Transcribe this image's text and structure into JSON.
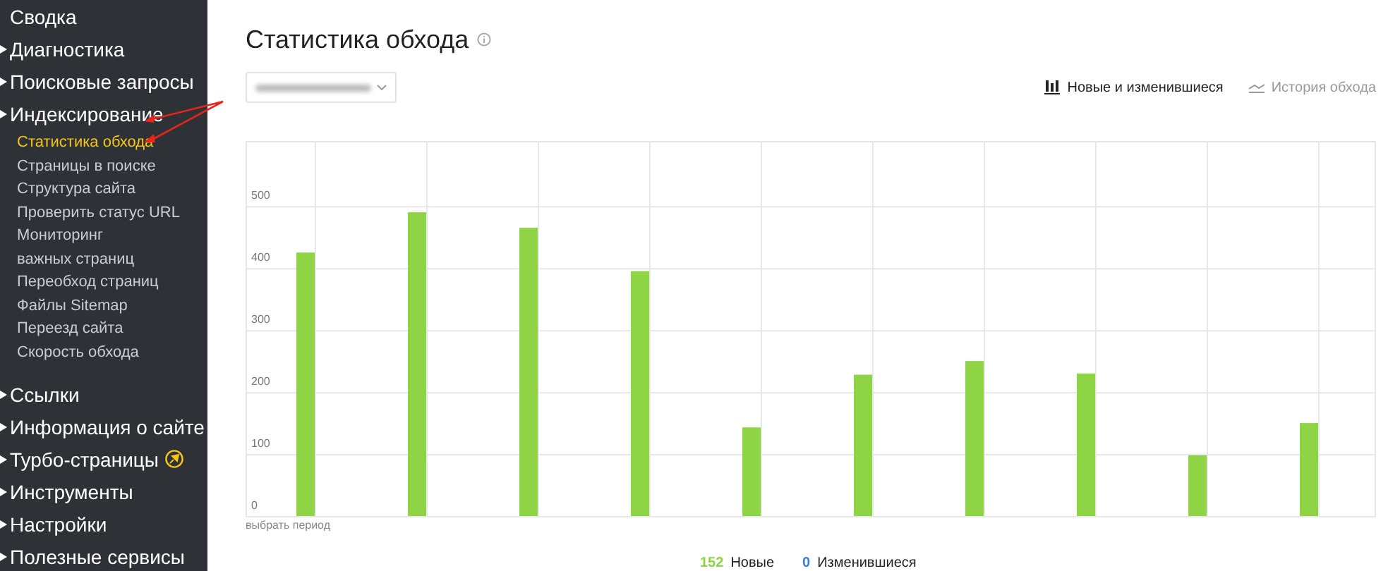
{
  "sidebar": {
    "items": [
      {
        "label": "Сводка",
        "kind": "link",
        "selected": false
      },
      {
        "label": "Диагностика",
        "kind": "group",
        "selected": false
      },
      {
        "label": "Поисковые запросы",
        "kind": "group",
        "selected": false
      },
      {
        "label": "Индексирование",
        "kind": "group",
        "selected": false,
        "children": [
          {
            "label": "Статистика обхода",
            "selected": true
          },
          {
            "label": "Страницы в поиске",
            "selected": false
          },
          {
            "label": "Структура сайта",
            "selected": false
          },
          {
            "label": "Проверить статус URL",
            "selected": false
          },
          {
            "label": "Мониторинг\nважных страниц",
            "selected": false
          },
          {
            "label": "Переобход страниц",
            "selected": false
          },
          {
            "label": "Файлы Sitemap",
            "selected": false
          },
          {
            "label": "Переезд сайта",
            "selected": false
          },
          {
            "label": "Скорость обхода",
            "selected": false
          }
        ]
      },
      {
        "label": "Ссылки",
        "kind": "group",
        "selected": false
      },
      {
        "label": "Информация о сайте",
        "kind": "group",
        "selected": false
      },
      {
        "label": "Турбо-страницы",
        "kind": "group",
        "selected": false,
        "rocket": true
      },
      {
        "label": "Инструменты",
        "kind": "group",
        "selected": false
      },
      {
        "label": "Настройки",
        "kind": "group",
        "selected": false
      },
      {
        "label": "Полезные сервисы",
        "kind": "group",
        "selected": false
      }
    ]
  },
  "page": {
    "title": "Статистика обхода",
    "tabs": [
      {
        "label": "Новые и изменившиеся",
        "selected": true,
        "kind": "bars"
      },
      {
        "label": "История обхода",
        "selected": false,
        "kind": "line"
      }
    ],
    "chart_data": {
      "type": "bar",
      "values": [
        425,
        490,
        465,
        395,
        143,
        228,
        250,
        230,
        98,
        150
      ],
      "ylim": [
        0,
        605
      ],
      "grid": true,
      "yticks": [
        0,
        100,
        200,
        300,
        400,
        500
      ]
    },
    "period_link": "выбрать период",
    "legend": [
      {
        "count": "152",
        "label": "Новые",
        "color": "#8fd444"
      },
      {
        "count": "0",
        "label": "Изменившиеся",
        "color": "#3d7fd1"
      }
    ]
  }
}
